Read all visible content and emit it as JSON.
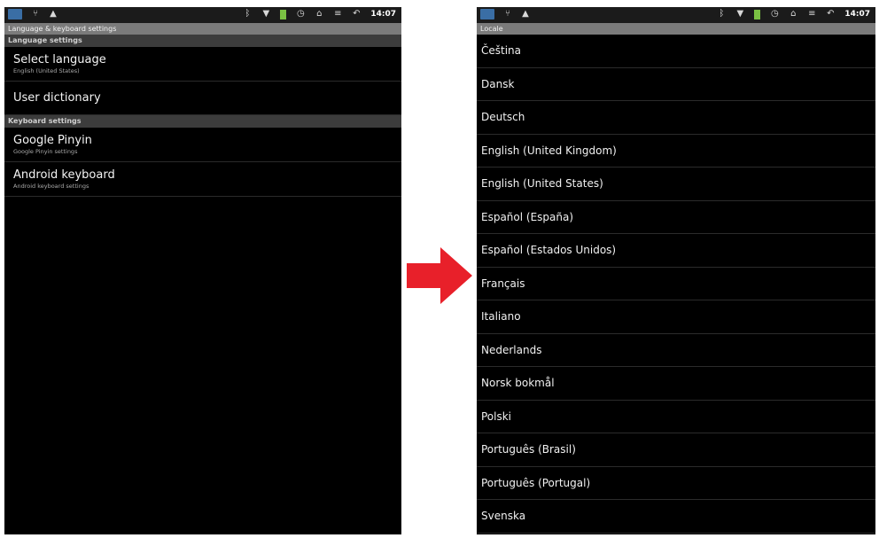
{
  "status_bar": {
    "time": "14:07",
    "colors": {
      "usb_icon": "#3a6ea5",
      "battery": "#7ac143"
    }
  },
  "left": {
    "title": "Language & keyboard settings",
    "sections": [
      {
        "header": "Language settings",
        "items": [
          {
            "title": "Select language",
            "summary": "English (United States)"
          },
          {
            "title": "User dictionary",
            "summary": ""
          }
        ]
      },
      {
        "header": "Keyboard settings",
        "items": [
          {
            "title": "Google Pinyin",
            "summary": "Google Pinyin settings"
          },
          {
            "title": "Android keyboard",
            "summary": "Android keyboard settings"
          }
        ]
      }
    ]
  },
  "right": {
    "title": "Locale",
    "locales": [
      "Čeština",
      "Dansk",
      "Deutsch",
      "English (United Kingdom)",
      "English (United States)",
      "Español (España)",
      "Español (Estados Unidos)",
      "Français",
      "Italiano",
      "Nederlands",
      "Norsk bokmål",
      "Polski",
      "Português (Brasil)",
      "Português (Portugal)",
      "Svenska"
    ]
  },
  "arrow": {
    "color": "#e8202a",
    "icon": "right-arrow-icon"
  }
}
